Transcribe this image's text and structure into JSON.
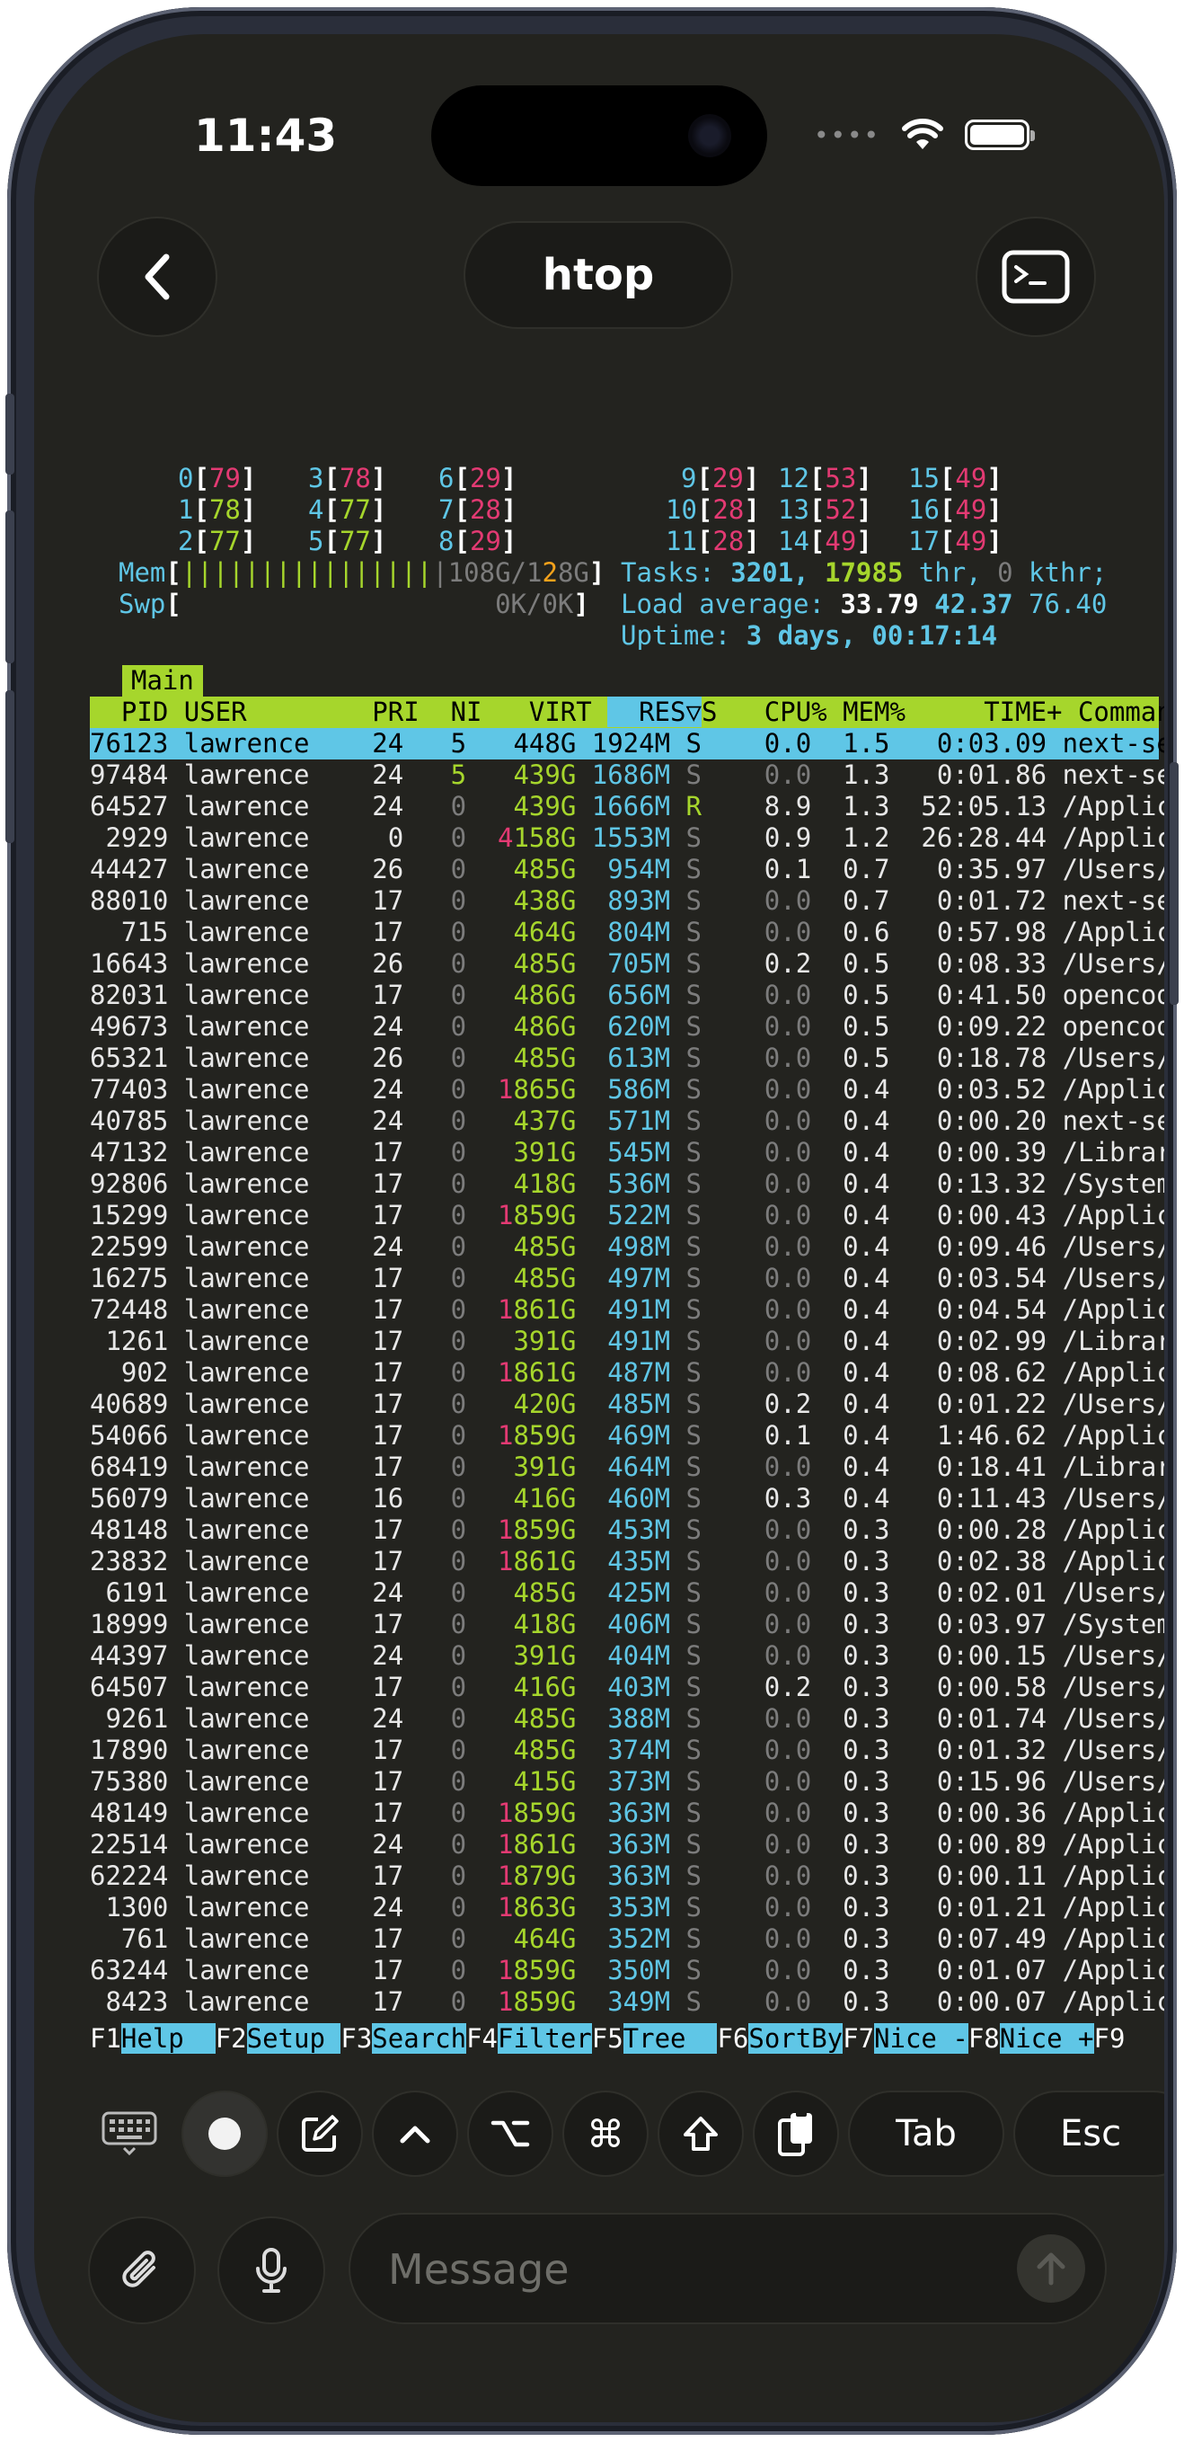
{
  "status_bar": {
    "time": "11:43"
  },
  "nav": {
    "title": "htop"
  },
  "cpu_meters": [
    {
      "id": "0",
      "val": "79",
      "color": "r"
    },
    {
      "id": "3",
      "val": "78",
      "color": "r"
    },
    {
      "id": "6",
      "val": "29",
      "color": "r"
    },
    {
      "id": "9",
      "val": "29",
      "color": "r"
    },
    {
      "id": "12",
      "val": "53",
      "color": "r"
    },
    {
      "id": "15",
      "val": "49",
      "color": "r"
    },
    {
      "id": "1",
      "val": "78",
      "color": "g"
    },
    {
      "id": "4",
      "val": "77",
      "color": "g"
    },
    {
      "id": "7",
      "val": "28",
      "color": "r"
    },
    {
      "id": "10",
      "val": "28",
      "color": "r"
    },
    {
      "id": "13",
      "val": "52",
      "color": "r"
    },
    {
      "id": "16",
      "val": "49",
      "color": "r"
    },
    {
      "id": "2",
      "val": "77",
      "color": "g"
    },
    {
      "id": "5",
      "val": "77",
      "color": "g"
    },
    {
      "id": "8",
      "val": "29",
      "color": "r"
    },
    {
      "id": "11",
      "val": "28",
      "color": "r"
    },
    {
      "id": "14",
      "val": "49",
      "color": "r"
    },
    {
      "id": "17",
      "val": "49",
      "color": "r"
    }
  ],
  "mem": {
    "label": "Mem",
    "bar": "||||||||||||||||",
    "used": "108G",
    "total": "128G"
  },
  "swp": {
    "label": "Swp",
    "value": "0K/0K"
  },
  "tasks": {
    "label": "Tasks:",
    "count": "3201,",
    "threads": "17985",
    "thr_label": "thr,",
    "kthr": "0",
    "kthr_label": "kthr;"
  },
  "load": {
    "label": "Load average:",
    "v1": "33.79",
    "v5": "42.37",
    "v15": "76.40"
  },
  "uptime": {
    "label": "Uptime:",
    "value": "3 days, 00:17:14"
  },
  "tab": "Main",
  "columns": [
    "PID",
    "USER",
    "PRI",
    "NI",
    "VIRT",
    "RES",
    "▽",
    "S",
    "CPU%",
    "MEM%",
    "TIME+",
    "Command"
  ],
  "processes": [
    [
      "76123",
      "lawrence",
      "24",
      "5",
      "448G",
      "1924M",
      "S",
      "0.0",
      "1.5",
      "0:03.09",
      "next-se"
    ],
    [
      "97484",
      "lawrence",
      "24",
      "5",
      "439G",
      "1686M",
      "S",
      "0.0",
      "1.3",
      "0:01.86",
      "next-se"
    ],
    [
      "64527",
      "lawrence",
      "24",
      "0",
      "439G",
      "1666M",
      "R",
      "8.9",
      "1.3",
      "52:05.13",
      "/Applic"
    ],
    [
      "2929",
      "lawrence",
      "0",
      "0",
      "4158G",
      "1553M",
      "S",
      "0.9",
      "1.2",
      "26:28.44",
      "/Applic"
    ],
    [
      "44427",
      "lawrence",
      "26",
      "0",
      "485G",
      "954M",
      "S",
      "0.1",
      "0.7",
      "0:35.97",
      "/Users/"
    ],
    [
      "88010",
      "lawrence",
      "17",
      "0",
      "438G",
      "893M",
      "S",
      "0.0",
      "0.7",
      "0:01.72",
      "next-se"
    ],
    [
      "715",
      "lawrence",
      "17",
      "0",
      "464G",
      "804M",
      "S",
      "0.0",
      "0.6",
      "0:57.98",
      "/Applic"
    ],
    [
      "16643",
      "lawrence",
      "26",
      "0",
      "485G",
      "705M",
      "S",
      "0.2",
      "0.5",
      "0:08.33",
      "/Users/"
    ],
    [
      "82031",
      "lawrence",
      "17",
      "0",
      "486G",
      "656M",
      "S",
      "0.0",
      "0.5",
      "0:41.50",
      "opencod"
    ],
    [
      "49673",
      "lawrence",
      "24",
      "0",
      "486G",
      "620M",
      "S",
      "0.0",
      "0.5",
      "0:09.22",
      "opencod"
    ],
    [
      "65321",
      "lawrence",
      "26",
      "0",
      "485G",
      "613M",
      "S",
      "0.0",
      "0.5",
      "0:18.78",
      "/Users/"
    ],
    [
      "77403",
      "lawrence",
      "24",
      "0",
      "1865G",
      "586M",
      "S",
      "0.0",
      "0.4",
      "0:03.52",
      "/Applic"
    ],
    [
      "40785",
      "lawrence",
      "24",
      "0",
      "437G",
      "571M",
      "S",
      "0.0",
      "0.4",
      "0:00.20",
      "next-se"
    ],
    [
      "47132",
      "lawrence",
      "17",
      "0",
      "391G",
      "545M",
      "S",
      "0.0",
      "0.4",
      "0:00.39",
      "/Librar"
    ],
    [
      "92806",
      "lawrence",
      "17",
      "0",
      "418G",
      "536M",
      "S",
      "0.0",
      "0.4",
      "0:13.32",
      "/System"
    ],
    [
      "15299",
      "lawrence",
      "17",
      "0",
      "1859G",
      "522M",
      "S",
      "0.0",
      "0.4",
      "0:00.43",
      "/Applic"
    ],
    [
      "22599",
      "lawrence",
      "24",
      "0",
      "485G",
      "498M",
      "S",
      "0.0",
      "0.4",
      "0:09.46",
      "/Users/"
    ],
    [
      "16275",
      "lawrence",
      "17",
      "0",
      "485G",
      "497M",
      "S",
      "0.0",
      "0.4",
      "0:03.54",
      "/Users/"
    ],
    [
      "72448",
      "lawrence",
      "17",
      "0",
      "1861G",
      "491M",
      "S",
      "0.0",
      "0.4",
      "0:04.54",
      "/Applic"
    ],
    [
      "1261",
      "lawrence",
      "17",
      "0",
      "391G",
      "491M",
      "S",
      "0.0",
      "0.4",
      "0:02.99",
      "/Librar"
    ],
    [
      "902",
      "lawrence",
      "17",
      "0",
      "1861G",
      "487M",
      "S",
      "0.0",
      "0.4",
      "0:08.62",
      "/Applic"
    ],
    [
      "40689",
      "lawrence",
      "17",
      "0",
      "420G",
      "485M",
      "S",
      "0.2",
      "0.4",
      "0:01.22",
      "/Users/"
    ],
    [
      "54066",
      "lawrence",
      "17",
      "0",
      "1859G",
      "469M",
      "S",
      "0.1",
      "0.4",
      "1:46.62",
      "/Applic"
    ],
    [
      "68419",
      "lawrence",
      "17",
      "0",
      "391G",
      "464M",
      "S",
      "0.0",
      "0.4",
      "0:18.41",
      "/Librar"
    ],
    [
      "56079",
      "lawrence",
      "16",
      "0",
      "416G",
      "460M",
      "S",
      "0.3",
      "0.4",
      "0:11.43",
      "/Users/"
    ],
    [
      "48148",
      "lawrence",
      "17",
      "0",
      "1859G",
      "453M",
      "S",
      "0.0",
      "0.3",
      "0:00.28",
      "/Applic"
    ],
    [
      "23832",
      "lawrence",
      "17",
      "0",
      "1861G",
      "435M",
      "S",
      "0.0",
      "0.3",
      "0:02.38",
      "/Applic"
    ],
    [
      "6191",
      "lawrence",
      "24",
      "0",
      "485G",
      "425M",
      "S",
      "0.0",
      "0.3",
      "0:02.01",
      "/Users/"
    ],
    [
      "18999",
      "lawrence",
      "17",
      "0",
      "418G",
      "406M",
      "S",
      "0.0",
      "0.3",
      "0:03.97",
      "/System"
    ],
    [
      "44397",
      "lawrence",
      "24",
      "0",
      "391G",
      "404M",
      "S",
      "0.0",
      "0.3",
      "0:00.15",
      "/Users/"
    ],
    [
      "64507",
      "lawrence",
      "17",
      "0",
      "416G",
      "403M",
      "S",
      "0.2",
      "0.3",
      "0:00.58",
      "/Users/"
    ],
    [
      "9261",
      "lawrence",
      "24",
      "0",
      "485G",
      "388M",
      "S",
      "0.0",
      "0.3",
      "0:01.74",
      "/Users/"
    ],
    [
      "17890",
      "lawrence",
      "17",
      "0",
      "485G",
      "374M",
      "S",
      "0.0",
      "0.3",
      "0:01.32",
      "/Users/"
    ],
    [
      "75380",
      "lawrence",
      "17",
      "0",
      "415G",
      "373M",
      "S",
      "0.0",
      "0.3",
      "0:15.96",
      "/Users/"
    ],
    [
      "48149",
      "lawrence",
      "17",
      "0",
      "1859G",
      "363M",
      "S",
      "0.0",
      "0.3",
      "0:00.36",
      "/Applic"
    ],
    [
      "22514",
      "lawrence",
      "24",
      "0",
      "1861G",
      "363M",
      "S",
      "0.0",
      "0.3",
      "0:00.89",
      "/Applic"
    ],
    [
      "62224",
      "lawrence",
      "17",
      "0",
      "1879G",
      "363M",
      "S",
      "0.0",
      "0.3",
      "0:00.11",
      "/Applic"
    ],
    [
      "1300",
      "lawrence",
      "24",
      "0",
      "1863G",
      "353M",
      "S",
      "0.0",
      "0.3",
      "0:01.21",
      "/Applic"
    ],
    [
      "761",
      "lawrence",
      "17",
      "0",
      "464G",
      "352M",
      "S",
      "0.0",
      "0.3",
      "0:07.49",
      "/Applic"
    ],
    [
      "63244",
      "lawrence",
      "17",
      "0",
      "1859G",
      "350M",
      "S",
      "0.0",
      "0.3",
      "0:01.07",
      "/Applic"
    ],
    [
      "8423",
      "lawrence",
      "17",
      "0",
      "1859G",
      "349M",
      "S",
      "0.0",
      "0.3",
      "0:00.07",
      "/Applic"
    ]
  ],
  "function_keys": [
    {
      "key": "F1",
      "label": "Help  "
    },
    {
      "key": "F2",
      "label": "Setup "
    },
    {
      "key": "F3",
      "label": "Search"
    },
    {
      "key": "F4",
      "label": "Filter"
    },
    {
      "key": "F5",
      "label": "Tree  "
    },
    {
      "key": "F6",
      "label": "SortBy"
    },
    {
      "key": "F7",
      "label": "Nice -"
    },
    {
      "key": "F8",
      "label": "Nice +"
    },
    {
      "key": "F9",
      "label": ""
    }
  ],
  "toolbar": {
    "tab_label": "Tab",
    "esc_label": "Esc"
  },
  "composer": {
    "placeholder": "Message"
  },
  "icons": [
    "back-chevron-icon",
    "terminal-icon",
    "keyboard-icon",
    "record-icon",
    "compose-icon",
    "ctrl-caret-icon",
    "option-key-icon",
    "command-key-icon",
    "shift-key-icon",
    "clipboard-icon",
    "paperclip-icon",
    "microphone-icon",
    "send-arrow-icon",
    "wifi-icon",
    "battery-icon"
  ],
  "colors": {
    "terminal_bg": "#23231f",
    "cyan": "#5fc6e6",
    "green": "#a6d62c",
    "red": "#e33a73",
    "orange": "#f4a21b"
  }
}
